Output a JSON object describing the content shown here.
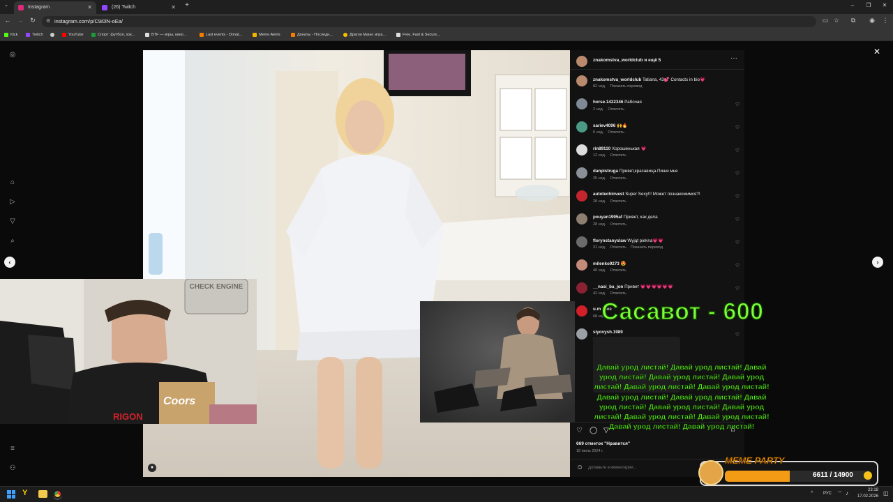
{
  "browser": {
    "tabs": [
      {
        "title": "Instagram",
        "active": true,
        "icon": "instagram-icon",
        "color": "#dd2a7b"
      },
      {
        "title": "(26) Twitch",
        "active": false,
        "icon": "twitch-icon",
        "color": "#9146ff"
      }
    ],
    "new_tab_label": "+",
    "url": "instagram.com/p/C9i0lN-oEa/",
    "bookmarks": [
      {
        "label": "Kick",
        "color": "#53fc18"
      },
      {
        "label": "Twitch",
        "color": "#9146ff"
      },
      {
        "label": "",
        "color": "#cccccc"
      },
      {
        "label": "YouTube",
        "color": "#ff0000"
      },
      {
        "label": "Спорт: футбол, хок...",
        "color": "#1a9a3a"
      },
      {
        "label": "BTF — игры, кино...",
        "color": "#dddddd"
      },
      {
        "label": "Last events - Donat...",
        "color": "#f57c00"
      },
      {
        "label": "Meme Alerts",
        "color": "#f2b400"
      },
      {
        "label": "Донаты - Последн...",
        "color": "#f57c00"
      },
      {
        "label": "Драгон Мани: игра...",
        "color": "#f2c200"
      },
      {
        "label": "Free, Fast & Secure...",
        "color": "#dddddd"
      }
    ]
  },
  "post": {
    "header_user": "znakomstva_worldclub и ещё 5",
    "comments": [
      {
        "user": "znakomstva_worldclub",
        "text": "Tatiana, 43💕 Contacts in bio💗",
        "time": "82 нед.",
        "action": "Показать перевод",
        "avatar_color": "#b98a6d",
        "like": false
      },
      {
        "user": "horse.1422346",
        "text": "Рабочая",
        "time": "2 нед.",
        "action": "Ответить",
        "avatar_color": "#7f8a95",
        "like": true
      },
      {
        "user": "sariev4096",
        "text": "🙌🔥",
        "time": "5 нед.",
        "action": "Ответить",
        "avatar_color": "#4a9a86",
        "like": true
      },
      {
        "user": "rin89110",
        "text": "Хорошенькая 💗",
        "time": "12 нед.",
        "action": "Ответить",
        "avatar_color": "#dddddd",
        "like": true
      },
      {
        "user": "danpistruga",
        "text": "Привет,красавица.Пиши мне",
        "time": "25 нед.",
        "action": "Ответить",
        "avatar_color": "#8a8f98",
        "like": true
      },
      {
        "user": "autotechinvest",
        "text": "Super Sexy!!! Может познакомимся?!",
        "time": "28 нед.",
        "action": "Ответить",
        "avatar_color": "#c4262e",
        "like": true
      },
      {
        "user": "pouyan1995af",
        "text": "Привет, как дела",
        "time": "28 нед.",
        "action": "Ответить",
        "avatar_color": "#8d8070",
        "like": true
      },
      {
        "user": "florynstanyslaw",
        "text": "Wyjąt piekna💗💗",
        "time": "31 нед.",
        "action": "Ответить",
        "action2": "Показать перевод",
        "avatar_color": "#6b6b6b",
        "like": true
      },
      {
        "user": "milenko9273",
        "text": "😍",
        "time": "40 нед.",
        "action": "Ответить",
        "avatar_color": "#c48a7a",
        "like": true
      },
      {
        "user": "__nasi_ba_jon",
        "text": "Привет 💗💗💗💗💗💗",
        "time": "42 нед.",
        "action": "Ответить",
        "avatar_color": "#8a2233",
        "like": true
      },
      {
        "user": "u.m",
        "text": "прив",
        "time": "68 нед.",
        "action": "",
        "avatar_color": "#d21f2a",
        "like": false
      },
      {
        "user": "siyovysh.1989",
        "text": "",
        "time": "69 нед.",
        "action": "",
        "avatar_color": "#9aa0a6",
        "like": true
      }
    ],
    "likes": "669 отметок \"Нравится\"",
    "date": "18 июль 2024 г.",
    "comment_placeholder": "Добавьте комментарий..."
  },
  "overlay": {
    "donation_title": "Сасавот - 600",
    "donation_message": "Давай урод листай! Давай урод листай! Давай урод листай! Давай урод листай! Давай урод листай! Давай урод листай! Давай урод листай! Давай урод листай! Давай урод листай! Давай урод листай! Давай урод листай! Давай урод листай! Давай урод листай! Давай урод листай! Давай урод листай! Давай урод листай!",
    "meme_party_label": "MEME PARTY",
    "meme_party_progress": "6611 / 14900",
    "meme_party_fraction": 0.444
  },
  "taskbar": {
    "lang": "РУС",
    "time": "23:18",
    "date": "17.02.2026"
  }
}
